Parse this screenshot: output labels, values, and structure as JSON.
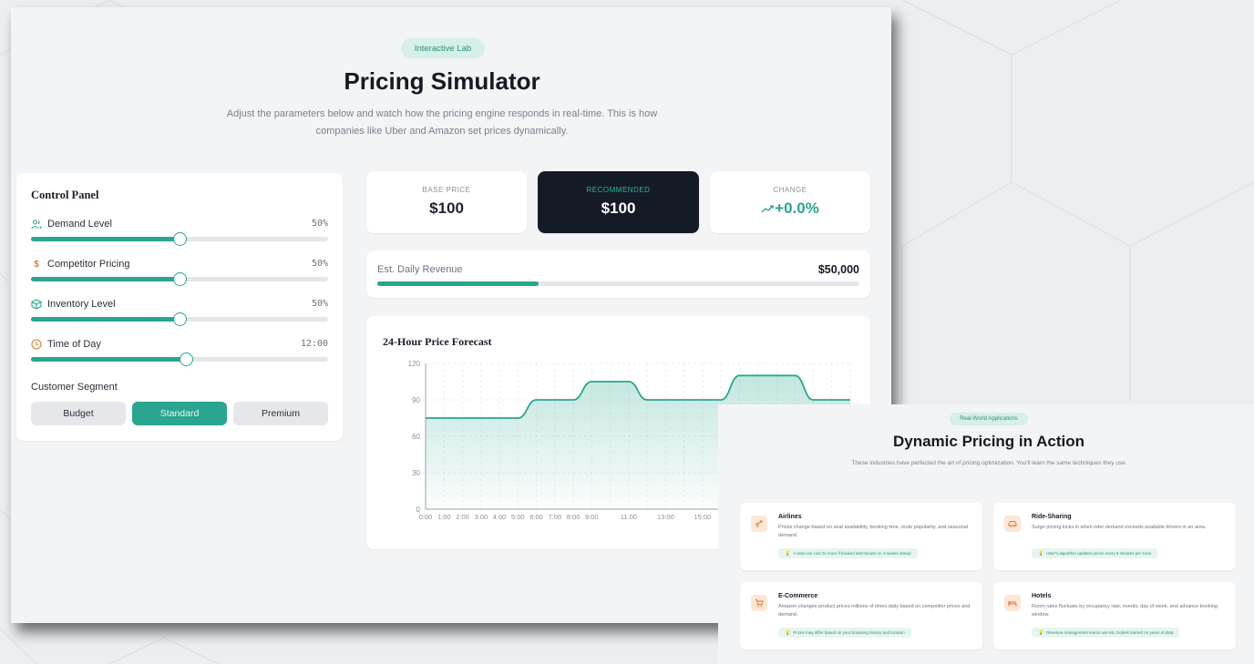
{
  "colors": {
    "accent": "#2aa58f",
    "dark_card": "#151b26",
    "badge_bg": "#d6efe8",
    "icon_bg": "#fde7d6",
    "icon_fg": "#e07a3a"
  },
  "simulator": {
    "badge": "Interactive Lab",
    "title": "Pricing Simulator",
    "subtitle": "Adjust the parameters below and watch how the pricing engine responds in real-time. This is how companies like Uber and Amazon set prices dynamically.",
    "control_panel": {
      "title": "Control Panel",
      "sliders": [
        {
          "icon": "users-icon",
          "label": "Demand Level",
          "value": "50%",
          "level": 0.5
        },
        {
          "icon": "dollar-icon",
          "label": "Competitor Pricing",
          "value": "50%",
          "level": 0.5
        },
        {
          "icon": "box-icon",
          "label": "Inventory Level",
          "value": "50%",
          "level": 0.5
        },
        {
          "icon": "clock-icon",
          "label": "Time of Day",
          "value": "12:00",
          "level": 0.522
        }
      ],
      "segment_label": "Customer Segment",
      "segments": [
        "Budget",
        "Standard",
        "Premium"
      ],
      "active_segment": "Standard"
    },
    "stats": {
      "base_label": "BASE PRICE",
      "base_value": "$100",
      "recommended_label": "RECOMMENDED",
      "recommended_value": "$100",
      "change_label": "CHANGE",
      "change_value": "+0.0%",
      "change_icon": "trend-up-icon"
    },
    "revenue": {
      "label": "Est. Daily Revenue",
      "value": "$50,000",
      "level": 0.335
    },
    "forecast": {
      "title": "24-Hour Price Forecast"
    }
  },
  "chart_data": {
    "type": "area",
    "title": "24-Hour Price Forecast",
    "x_tick_labels": [
      "0:00",
      "1:00",
      "2:00",
      "3:00",
      "4:00",
      "5:00",
      "6:00",
      "7:00",
      "8:00",
      "9:00",
      "11:00",
      "13:00",
      "15:00"
    ],
    "x": [
      0,
      1,
      2,
      3,
      4,
      5,
      6,
      7,
      8,
      9,
      10,
      11,
      12,
      13,
      14,
      15,
      16,
      17,
      18,
      19,
      20,
      21,
      22,
      23
    ],
    "values": [
      75,
      75,
      75,
      75,
      75,
      75,
      90,
      90,
      90,
      105,
      105,
      105,
      90,
      90,
      90,
      90,
      90,
      110,
      110,
      110,
      110,
      90,
      90,
      90
    ],
    "ylim": [
      0,
      120
    ],
    "y_ticks": [
      0,
      30,
      60,
      90,
      120
    ],
    "y_tick_labels": [
      "0",
      "30",
      "60",
      "90",
      "120"
    ],
    "grid": true
  },
  "applications": {
    "badge": "Real-World Applications",
    "title": "Dynamic Pricing in Action",
    "subtitle": "These industries have perfected the art of pricing optimization. You'll learn the same techniques they use.",
    "industries": [
      {
        "icon": "plane-icon",
        "name": "Airlines",
        "desc": "Prices change based on seat availability, booking time, route popularity, and seasonal demand.",
        "tip": "A seat can cost 3x more if booked last-minute vs. 3 weeks ahead"
      },
      {
        "icon": "car-icon",
        "name": "Ride-Sharing",
        "desc": "Surge pricing kicks in when rider demand exceeds available drivers in an area.",
        "tip": "Uber's algorithm updates prices every 5 minutes per zone"
      },
      {
        "icon": "cart-icon",
        "name": "E-Commerce",
        "desc": "Amazon changes product prices millions of times daily based on competitor prices and demand.",
        "tip": "Prices may differ based on your browsing history and location"
      },
      {
        "icon": "bed-icon",
        "name": "Hotels",
        "desc": "Room rates fluctuate by occupancy rate, events, day of week, and advance booking window.",
        "tip": "Revenue management teams use ML models trained on years of data"
      }
    ]
  }
}
